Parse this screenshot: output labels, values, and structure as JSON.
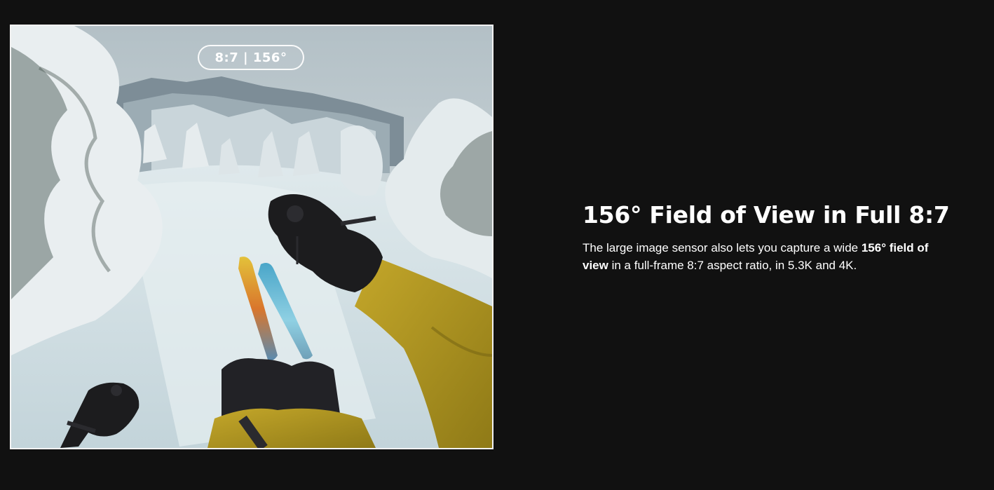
{
  "media": {
    "image_alt": "First-person skier view descending a snowy forest trail toward mountains",
    "badge_label": "8:7 | 156°"
  },
  "feature": {
    "headline": "156° Field of View in Full 8:7",
    "body_prefix": "The large image sensor also lets you capture a wide ",
    "body_highlight": "156° field of view",
    "body_suffix": " in a full-frame 8:7 aspect ratio, in 5.3K and 4K."
  },
  "colors": {
    "background": "#111111",
    "text": "#ffffff",
    "frame_border": "#f2f2f2",
    "jacket_mustard": "#b39a22",
    "glove_black": "#1c1c1e"
  }
}
